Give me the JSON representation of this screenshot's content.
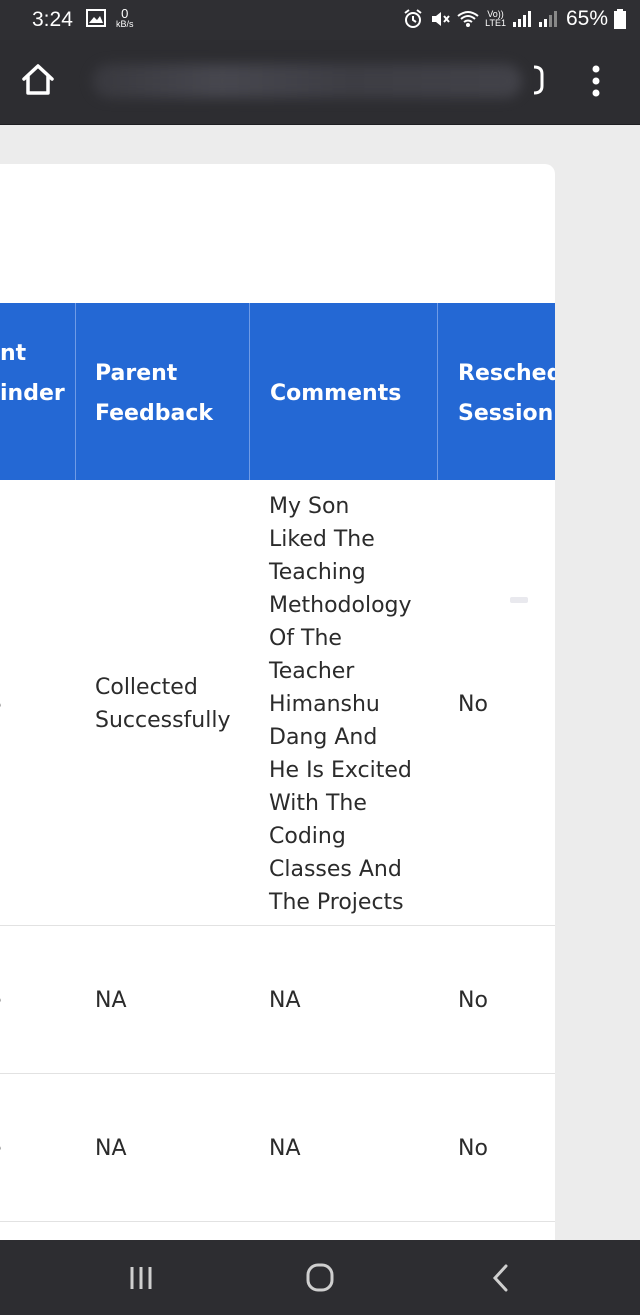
{
  "status_bar": {
    "time": "3:24",
    "net_speed_value": "0",
    "net_speed_unit": "kB/s",
    "volte": "Vo))",
    "lte": "LTE1",
    "battery": "65%"
  },
  "browser": {
    "home_icon": "home-icon",
    "menu_icon": "more-vert-icon"
  },
  "table": {
    "columns": [
      {
        "line1": "nt",
        "line2": "inder"
      },
      {
        "line1": "Parent",
        "line2": "Feedback"
      },
      {
        "line1": "Comments",
        "line2": ""
      },
      {
        "line1": "Resched",
        "line2": "Session"
      }
    ],
    "rows": [
      {
        "partial": "e",
        "feedback_line1": "Collected",
        "feedback_line2": "Successfully",
        "comments": [
          "My Son",
          "Liked The",
          "Teaching",
          "Methodology",
          "Of The",
          "Teacher",
          "Himanshu",
          "Dang And",
          "He Is Excited",
          "With The",
          "Coding",
          "Classes And",
          "The Projects"
        ],
        "resched": "No"
      },
      {
        "partial": "e",
        "feedback_line1": "NA",
        "feedback_line2": "",
        "comments": [
          "NA"
        ],
        "resched": "No"
      },
      {
        "partial": "e",
        "feedback_line1": "NA",
        "feedback_line2": "",
        "comments": [
          "NA"
        ],
        "resched": "No"
      }
    ]
  },
  "nav_bar": {
    "recents_icon": "recents-icon",
    "home_icon": "home-circle-icon",
    "back_icon": "back-chevron-icon"
  }
}
